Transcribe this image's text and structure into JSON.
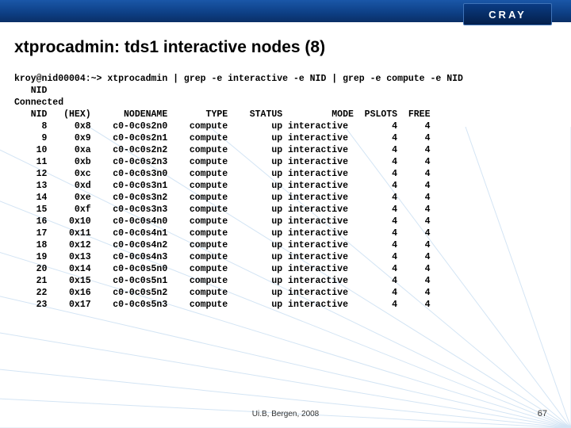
{
  "brand": "CRAY",
  "title": "xtprocadmin: tds1 interactive nodes (8)",
  "command": "kroy@nid00004:~> xtprocadmin | grep -e interactive -e NID | grep -e compute -e NID",
  "pre_line": "Connected",
  "columns": [
    "NID",
    "(HEX)",
    "NODENAME",
    "TYPE",
    "STATUS",
    "MODE",
    "PSLOTS",
    "FREE"
  ],
  "rows": [
    {
      "nid": "8",
      "hex": "0x8",
      "nodename": "c0-0c0s2n0",
      "type": "compute",
      "status": "up",
      "mode": "interactive",
      "pslots": "4",
      "free": "4"
    },
    {
      "nid": "9",
      "hex": "0x9",
      "nodename": "c0-0c0s2n1",
      "type": "compute",
      "status": "up",
      "mode": "interactive",
      "pslots": "4",
      "free": "4"
    },
    {
      "nid": "10",
      "hex": "0xa",
      "nodename": "c0-0c0s2n2",
      "type": "compute",
      "status": "up",
      "mode": "interactive",
      "pslots": "4",
      "free": "4"
    },
    {
      "nid": "11",
      "hex": "0xb",
      "nodename": "c0-0c0s2n3",
      "type": "compute",
      "status": "up",
      "mode": "interactive",
      "pslots": "4",
      "free": "4"
    },
    {
      "nid": "12",
      "hex": "0xc",
      "nodename": "c0-0c0s3n0",
      "type": "compute",
      "status": "up",
      "mode": "interactive",
      "pslots": "4",
      "free": "4"
    },
    {
      "nid": "13",
      "hex": "0xd",
      "nodename": "c0-0c0s3n1",
      "type": "compute",
      "status": "up",
      "mode": "interactive",
      "pslots": "4",
      "free": "4"
    },
    {
      "nid": "14",
      "hex": "0xe",
      "nodename": "c0-0c0s3n2",
      "type": "compute",
      "status": "up",
      "mode": "interactive",
      "pslots": "4",
      "free": "4"
    },
    {
      "nid": "15",
      "hex": "0xf",
      "nodename": "c0-0c0s3n3",
      "type": "compute",
      "status": "up",
      "mode": "interactive",
      "pslots": "4",
      "free": "4"
    },
    {
      "nid": "16",
      "hex": "0x10",
      "nodename": "c0-0c0s4n0",
      "type": "compute",
      "status": "up",
      "mode": "interactive",
      "pslots": "4",
      "free": "4"
    },
    {
      "nid": "17",
      "hex": "0x11",
      "nodename": "c0-0c0s4n1",
      "type": "compute",
      "status": "up",
      "mode": "interactive",
      "pslots": "4",
      "free": "4"
    },
    {
      "nid": "18",
      "hex": "0x12",
      "nodename": "c0-0c0s4n2",
      "type": "compute",
      "status": "up",
      "mode": "interactive",
      "pslots": "4",
      "free": "4"
    },
    {
      "nid": "19",
      "hex": "0x13",
      "nodename": "c0-0c0s4n3",
      "type": "compute",
      "status": "up",
      "mode": "interactive",
      "pslots": "4",
      "free": "4"
    },
    {
      "nid": "20",
      "hex": "0x14",
      "nodename": "c0-0c0s5n0",
      "type": "compute",
      "status": "up",
      "mode": "interactive",
      "pslots": "4",
      "free": "4"
    },
    {
      "nid": "21",
      "hex": "0x15",
      "nodename": "c0-0c0s5n1",
      "type": "compute",
      "status": "up",
      "mode": "interactive",
      "pslots": "4",
      "free": "4"
    },
    {
      "nid": "22",
      "hex": "0x16",
      "nodename": "c0-0c0s5n2",
      "type": "compute",
      "status": "up",
      "mode": "interactive",
      "pslots": "4",
      "free": "4"
    },
    {
      "nid": "23",
      "hex": "0x17",
      "nodename": "c0-0c0s5n3",
      "type": "compute",
      "status": "up",
      "mode": "interactive",
      "pslots": "4",
      "free": "4"
    }
  ],
  "footer": {
    "center": "Ui.B, Bergen, 2008",
    "page": "67"
  }
}
